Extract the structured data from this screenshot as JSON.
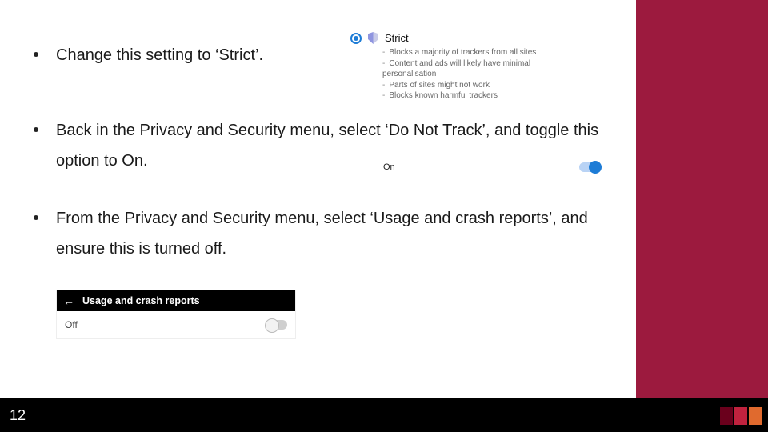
{
  "page_number": "12",
  "bullets": [
    "Change this setting to ‘Strict’.",
    "Back in the Privacy and Security menu, select ‘Do Not Track’, and toggle this option to On.",
    "From the Privacy and Security menu, select ‘Usage and crash reports’, and ensure this is turned off."
  ],
  "strict_option": {
    "title": "Strict",
    "lines": [
      "Blocks a majority of trackers from all sites",
      "Content and ads will likely have minimal personalisation",
      "Parts of sites might not work",
      "Blocks known harmful trackers"
    ]
  },
  "do_not_track": {
    "label": "On",
    "state": "on"
  },
  "usage_reports": {
    "header": "Usage and crash reports",
    "label": "Off",
    "state": "off"
  }
}
